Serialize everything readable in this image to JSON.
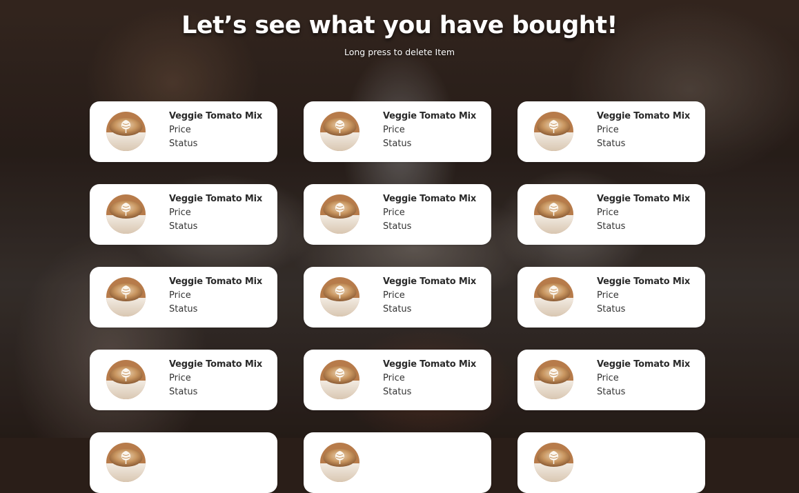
{
  "header": {
    "title": "Let’s see what you have bought!",
    "subtitle": "Long press to delete Item"
  },
  "items": [
    {
      "name": "Veggie Tomato Mix",
      "price_label": "Price",
      "status_label": "Status",
      "icon": "latte-cup-image"
    },
    {
      "name": "Veggie Tomato Mix",
      "price_label": "Price",
      "status_label": "Status",
      "icon": "latte-cup-image"
    },
    {
      "name": "Veggie Tomato Mix",
      "price_label": "Price",
      "status_label": "Status",
      "icon": "latte-cup-image"
    },
    {
      "name": "Veggie Tomato Mix",
      "price_label": "Price",
      "status_label": "Status",
      "icon": "latte-cup-image"
    },
    {
      "name": "Veggie Tomato Mix",
      "price_label": "Price",
      "status_label": "Status",
      "icon": "latte-cup-image"
    },
    {
      "name": "Veggie Tomato Mix",
      "price_label": "Price",
      "status_label": "Status",
      "icon": "latte-cup-image"
    },
    {
      "name": "Veggie Tomato Mix",
      "price_label": "Price",
      "status_label": "Status",
      "icon": "latte-cup-image"
    },
    {
      "name": "Veggie Tomato Mix",
      "price_label": "Price",
      "status_label": "Status",
      "icon": "latte-cup-image"
    },
    {
      "name": "Veggie Tomato Mix",
      "price_label": "Price",
      "status_label": "Status",
      "icon": "latte-cup-image"
    },
    {
      "name": "Veggie Tomato Mix",
      "price_label": "Price",
      "status_label": "Status",
      "icon": "latte-cup-image"
    },
    {
      "name": "Veggie Tomato Mix",
      "price_label": "Price",
      "status_label": "Status",
      "icon": "latte-cup-image"
    },
    {
      "name": "Veggie Tomato Mix",
      "price_label": "Price",
      "status_label": "Status",
      "icon": "latte-cup-image"
    },
    {
      "name": "",
      "price_label": "",
      "status_label": "",
      "icon": "latte-cup-image"
    },
    {
      "name": "",
      "price_label": "",
      "status_label": "",
      "icon": "latte-cup-image"
    },
    {
      "name": "",
      "price_label": "",
      "status_label": "",
      "icon": "latte-cup-image"
    }
  ],
  "colors": {
    "card_background": "#ffffff",
    "title_text": "#ffffff",
    "item_text": "#2a2a2a"
  }
}
